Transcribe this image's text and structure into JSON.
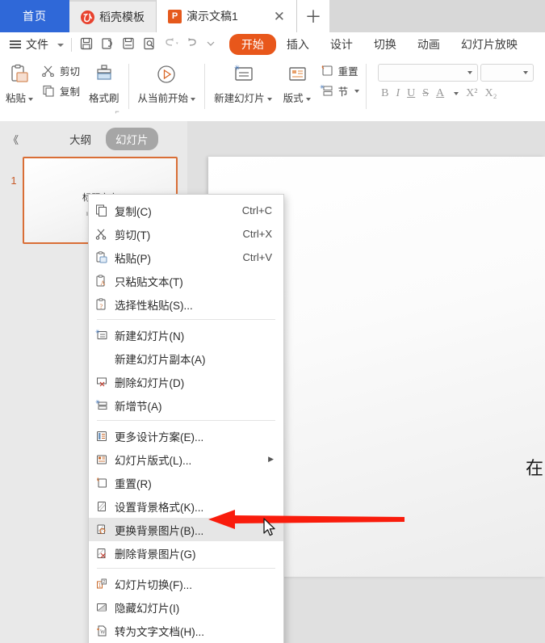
{
  "tabbar": {
    "home_label": "首页",
    "tabs": [
      {
        "label": "稻壳模板",
        "icon": "docer-icon"
      },
      {
        "label": "演示文稿1",
        "icon": "ppt-icon"
      }
    ],
    "close_glyph": "✕",
    "new_tab_glyph": "＋"
  },
  "menubar": {
    "file_label": "文件",
    "quick_icons": [
      "save-icon",
      "undo-redo-icon",
      "print-icon",
      "print-preview-icon",
      "undo-icon",
      "redo-icon",
      "customize-icon"
    ],
    "ribbon_tabs": [
      {
        "label": "开始",
        "active": true
      },
      {
        "label": "插入",
        "active": false
      },
      {
        "label": "设计",
        "active": false
      },
      {
        "label": "切换",
        "active": false
      },
      {
        "label": "动画",
        "active": false
      },
      {
        "label": "幻灯片放映",
        "active": false
      }
    ],
    "accent_color": "#e8571b"
  },
  "ribbon": {
    "paste_label": "粘贴",
    "cut_label": "剪切",
    "copy_label": "复制",
    "format_painter_label": "格式刷",
    "from_current_label": "从当前开始",
    "new_slide_label": "新建幻灯片",
    "layout_label": "版式",
    "reset_label": "重置",
    "section_label": "节",
    "font_name_value": "",
    "font_size_value": "",
    "font_buttons": [
      "B",
      "I",
      "U",
      "S",
      "A",
      "X²",
      "X₂"
    ]
  },
  "left_panel": {
    "collapse_glyph": "《",
    "tabs": [
      {
        "label": "大纲",
        "active": false
      },
      {
        "label": "幻灯片",
        "active": true
      }
    ],
    "slides": [
      {
        "number": "1",
        "title": "标题文字",
        "subtitle": "副标题文字内容"
      }
    ]
  },
  "canvas": {
    "slide_text": "在"
  },
  "context_menu": {
    "items": [
      {
        "label": "复制(C)",
        "shortcut": "Ctrl+C",
        "icon": "copy-icon",
        "sep_after": false,
        "submenu": false,
        "highlight": false
      },
      {
        "label": "剪切(T)",
        "shortcut": "Ctrl+X",
        "icon": "cut-icon",
        "sep_after": false,
        "submenu": false,
        "highlight": false
      },
      {
        "label": "粘贴(P)",
        "shortcut": "Ctrl+V",
        "icon": "paste-icon",
        "sep_after": false,
        "submenu": false,
        "highlight": false
      },
      {
        "label": "只粘贴文本(T)",
        "shortcut": "",
        "icon": "paste-text-icon",
        "sep_after": false,
        "submenu": false,
        "highlight": false
      },
      {
        "label": "选择性粘贴(S)...",
        "shortcut": "",
        "icon": "paste-special-icon",
        "sep_after": true,
        "submenu": false,
        "highlight": false
      },
      {
        "label": "新建幻灯片(N)",
        "shortcut": "",
        "icon": "new-slide-icon",
        "sep_after": false,
        "submenu": false,
        "highlight": false
      },
      {
        "label": "新建幻灯片副本(A)",
        "shortcut": "",
        "icon": "none",
        "sep_after": false,
        "submenu": false,
        "highlight": false
      },
      {
        "label": "删除幻灯片(D)",
        "shortcut": "",
        "icon": "delete-slide-icon",
        "sep_after": false,
        "submenu": false,
        "highlight": false
      },
      {
        "label": "新增节(A)",
        "shortcut": "",
        "icon": "add-section-icon",
        "sep_after": true,
        "submenu": false,
        "highlight": false
      },
      {
        "label": "更多设计方案(E)...",
        "shortcut": "",
        "icon": "more-design-icon",
        "sep_after": false,
        "submenu": false,
        "highlight": false
      },
      {
        "label": "幻灯片版式(L)...",
        "shortcut": "",
        "icon": "slide-layout-icon",
        "sep_after": false,
        "submenu": true,
        "highlight": false
      },
      {
        "label": "重置(R)",
        "shortcut": "",
        "icon": "reset-icon",
        "sep_after": false,
        "submenu": false,
        "highlight": false
      },
      {
        "label": "设置背景格式(K)...",
        "shortcut": "",
        "icon": "bg-format-icon",
        "sep_after": false,
        "submenu": false,
        "highlight": false
      },
      {
        "label": "更换背景图片(B)...",
        "shortcut": "",
        "icon": "replace-bg-icon",
        "sep_after": false,
        "submenu": false,
        "highlight": true
      },
      {
        "label": "删除背景图片(G)",
        "shortcut": "",
        "icon": "delete-bg-icon",
        "sep_after": true,
        "submenu": false,
        "highlight": false
      },
      {
        "label": "幻灯片切换(F)...",
        "shortcut": "",
        "icon": "slide-transition-icon",
        "sep_after": false,
        "submenu": false,
        "highlight": false
      },
      {
        "label": "隐藏幻灯片(I)",
        "shortcut": "",
        "icon": "hide-slide-icon",
        "sep_after": false,
        "submenu": false,
        "highlight": false
      },
      {
        "label": "转为文字文档(H)...",
        "shortcut": "",
        "icon": "to-doc-icon",
        "sep_after": false,
        "submenu": false,
        "highlight": false
      }
    ],
    "submenu_glyph": "▶"
  },
  "annotation": {
    "arrow_color": "#f91c0c",
    "arrow_name": "red-pointer-arrow"
  }
}
